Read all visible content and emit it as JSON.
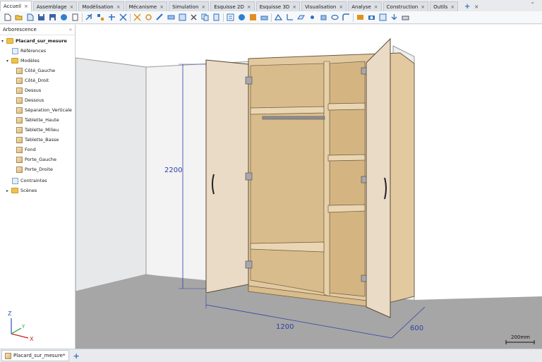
{
  "tabs": [
    {
      "label": "Accueil",
      "active": true
    },
    {
      "label": "Assemblage",
      "active": false
    },
    {
      "label": "Modélisation",
      "active": false
    },
    {
      "label": "Mécanisme",
      "active": false
    },
    {
      "label": "Simulation",
      "active": false
    },
    {
      "label": "Esquisse 2D",
      "active": false
    },
    {
      "label": "Esquisse 3D",
      "active": false
    },
    {
      "label": "Visualisation",
      "active": false
    },
    {
      "label": "Analyse",
      "active": false
    },
    {
      "label": "Construction",
      "active": false
    },
    {
      "label": "Outils",
      "active": false
    }
  ],
  "tab_close": "×",
  "tab_add": "+",
  "sidebar": {
    "title": "Arborescence",
    "pin": "«",
    "root": "Placard_sur_mesure",
    "references": "Références",
    "models_folder": "Modèles",
    "models": [
      "Côté_Gauche",
      "Côté_Droit",
      "Dessus",
      "Dessous",
      "Séparation_Verticale",
      "Tablette_Haute",
      "Tablette_Milieu",
      "Tablette_Basse",
      "Fond",
      "Porte_Gauche",
      "Porte_Droite"
    ],
    "constraints": "Contraintes",
    "scenes": "Scènes",
    "axes": {
      "z": "Z",
      "y": "Y",
      "x": "X"
    }
  },
  "viewport": {
    "dim_height": "2200",
    "dim_width": "1200",
    "dim_depth": "600",
    "scale_label": "200mm"
  },
  "bottom": {
    "doc_tab": "Placard_sur_mesure*",
    "doc_add": "+"
  }
}
